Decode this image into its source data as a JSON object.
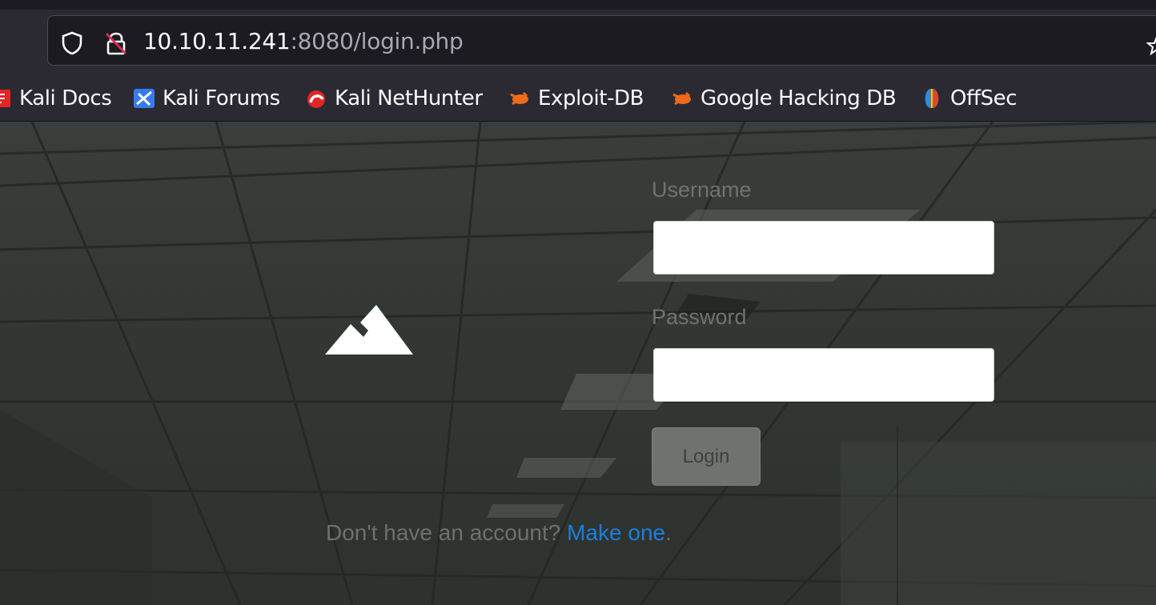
{
  "browser": {
    "url_host": "10.10.11.241",
    "url_rest": ":8080/login.php"
  },
  "bookmarks": [
    {
      "label": "Kali Docs",
      "icon": "kali-docs-icon"
    },
    {
      "label": "Kali Forums",
      "icon": "kali-forums-icon"
    },
    {
      "label": "Kali NetHunter",
      "icon": "kali-nethunter-icon"
    },
    {
      "label": "Exploit-DB",
      "icon": "exploit-db-icon"
    },
    {
      "label": "Google Hacking DB",
      "icon": "google-hacking-db-icon"
    },
    {
      "label": "OffSec",
      "icon": "offsec-icon"
    }
  ],
  "login": {
    "username_label": "Username",
    "username_value": "",
    "password_label": "Password",
    "password_value": "",
    "button_label": "Login",
    "signup_text": "Don't have an account?",
    "signup_link": "Make one",
    "signup_suffix": "."
  },
  "colors": {
    "link": "#1a7ee0",
    "chrome_bg": "#2b2a33",
    "urlbar_bg": "#1c1b22"
  }
}
